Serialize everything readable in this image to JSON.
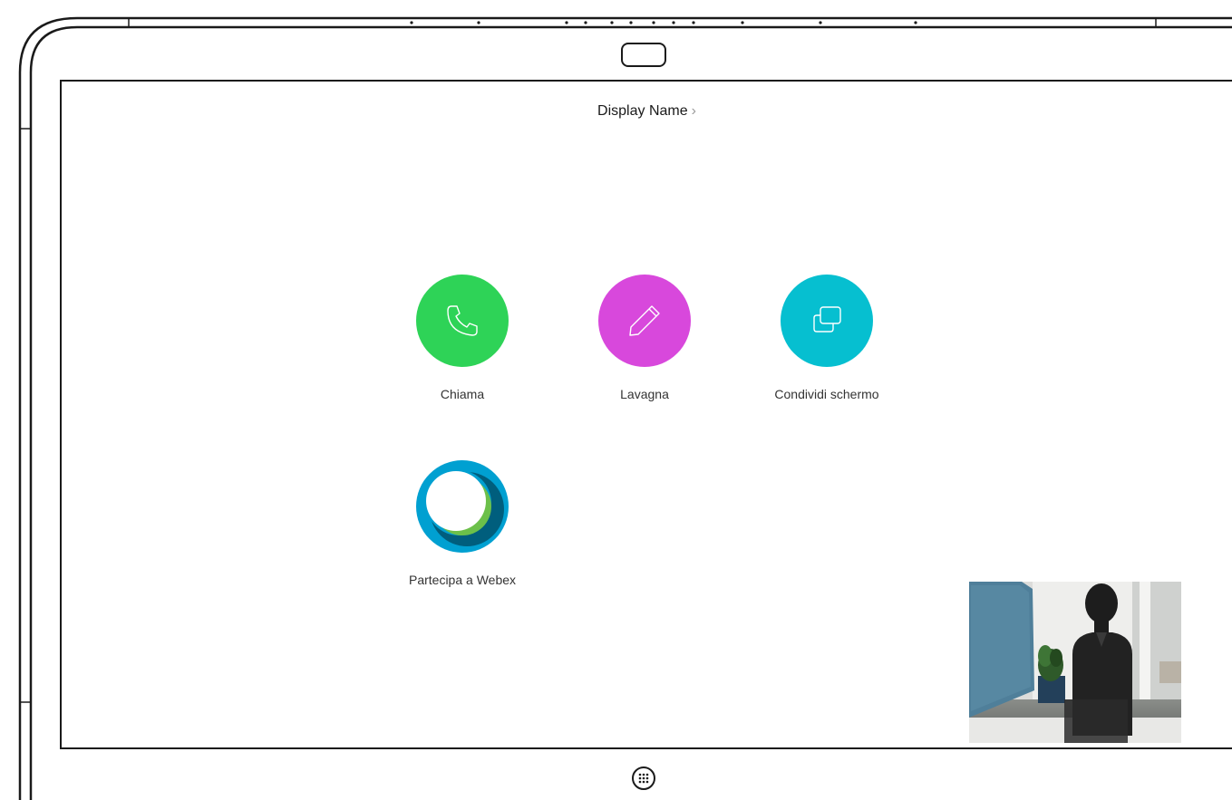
{
  "header": {
    "display_name": "Display Name",
    "chevron": "›"
  },
  "apps": [
    {
      "label": "Chiama",
      "icon": "phone-icon",
      "color": "#2ed357"
    },
    {
      "label": "Lavagna",
      "icon": "pencil-icon",
      "color": "#d848dc"
    },
    {
      "label": "Condividi schermo",
      "icon": "share-screen-icon",
      "color": "#06bfd0"
    },
    {
      "label": "Partecipa a Webex",
      "icon": "webex-logo-icon",
      "colors": [
        "#00a0d1",
        "#6cc04a",
        "#005e7d"
      ]
    }
  ],
  "selfview": {
    "icon": "selfview-camera-preview"
  },
  "home": {
    "icon": "app-grid-icon"
  }
}
